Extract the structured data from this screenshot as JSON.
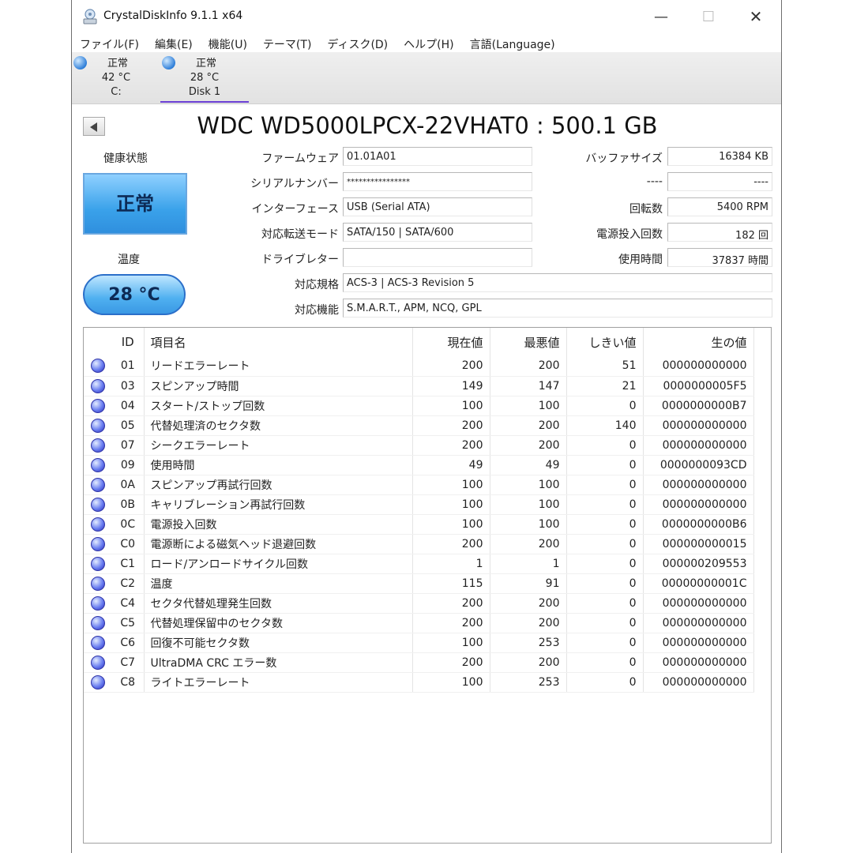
{
  "window": {
    "title": "CrystalDiskInfo 9.1.1 x64"
  },
  "menu": [
    "ファイル(F)",
    "編集(E)",
    "機能(U)",
    "テーマ(T)",
    "ディスク(D)",
    "ヘルプ(H)",
    "言語(Language)"
  ],
  "disks": [
    {
      "status": "正常",
      "temp": "42 °C",
      "name": "C:"
    },
    {
      "status": "正常",
      "temp": "28 °C",
      "name": "Disk 1"
    }
  ],
  "model": "WDC WD5000LPCX-22VHAT0 : 500.1 GB",
  "health": {
    "label": "健康状態",
    "value": "正常"
  },
  "temperature": {
    "label": "温度",
    "value": "28 °C"
  },
  "info": {
    "firmware_label": "ファームウェア",
    "firmware": "01.01A01",
    "serial_label": "シリアルナンバー",
    "serial": "****************",
    "interface_label": "インターフェース",
    "interface": "USB (Serial ATA)",
    "transfer_label": "対応転送モード",
    "transfer": "SATA/150 | SATA/600",
    "drive_letter_label": "ドライブレター",
    "drive_letter": "",
    "standard_label": "対応規格",
    "standard": "ACS-3 | ACS-3 Revision 5",
    "features_label": "対応機能",
    "features": "S.M.A.R.T., APM, NCQ, GPL",
    "buffer_label": "バッファサイズ",
    "buffer": "16384 KB",
    "blank_label": "----",
    "blank": "----",
    "rotation_label": "回転数",
    "rotation": "5400 RPM",
    "power_count_label": "電源投入回数",
    "power_count": "182 回",
    "power_hours_label": "使用時間",
    "power_hours": "37837 時間"
  },
  "smart": {
    "headers": {
      "id": "ID",
      "name": "項目名",
      "current": "現在値",
      "worst": "最悪値",
      "threshold": "しきい値",
      "raw": "生の値"
    },
    "rows": [
      {
        "id": "01",
        "name": "リードエラーレート",
        "current": "200",
        "worst": "200",
        "threshold": "51",
        "raw": "000000000000"
      },
      {
        "id": "03",
        "name": "スピンアップ時間",
        "current": "149",
        "worst": "147",
        "threshold": "21",
        "raw": "0000000005F5"
      },
      {
        "id": "04",
        "name": "スタート/ストップ回数",
        "current": "100",
        "worst": "100",
        "threshold": "0",
        "raw": "0000000000B7"
      },
      {
        "id": "05",
        "name": "代替処理済のセクタ数",
        "current": "200",
        "worst": "200",
        "threshold": "140",
        "raw": "000000000000"
      },
      {
        "id": "07",
        "name": "シークエラーレート",
        "current": "200",
        "worst": "200",
        "threshold": "0",
        "raw": "000000000000"
      },
      {
        "id": "09",
        "name": "使用時間",
        "current": "49",
        "worst": "49",
        "threshold": "0",
        "raw": "0000000093CD"
      },
      {
        "id": "0A",
        "name": "スピンアップ再試行回数",
        "current": "100",
        "worst": "100",
        "threshold": "0",
        "raw": "000000000000"
      },
      {
        "id": "0B",
        "name": "キャリブレーション再試行回数",
        "current": "100",
        "worst": "100",
        "threshold": "0",
        "raw": "000000000000"
      },
      {
        "id": "0C",
        "name": "電源投入回数",
        "current": "100",
        "worst": "100",
        "threshold": "0",
        "raw": "0000000000B6"
      },
      {
        "id": "C0",
        "name": "電源断による磁気ヘッド退避回数",
        "current": "200",
        "worst": "200",
        "threshold": "0",
        "raw": "000000000015"
      },
      {
        "id": "C1",
        "name": "ロード/アンロードサイクル回数",
        "current": "1",
        "worst": "1",
        "threshold": "0",
        "raw": "000000209553"
      },
      {
        "id": "C2",
        "name": "温度",
        "current": "115",
        "worst": "91",
        "threshold": "0",
        "raw": "00000000001C"
      },
      {
        "id": "C4",
        "name": "セクタ代替処理発生回数",
        "current": "200",
        "worst": "200",
        "threshold": "0",
        "raw": "000000000000"
      },
      {
        "id": "C5",
        "name": "代替処理保留中のセクタ数",
        "current": "200",
        "worst": "200",
        "threshold": "0",
        "raw": "000000000000"
      },
      {
        "id": "C6",
        "name": "回復不可能セクタ数",
        "current": "100",
        "worst": "253",
        "threshold": "0",
        "raw": "000000000000"
      },
      {
        "id": "C7",
        "name": "UltraDMA CRC エラー数",
        "current": "200",
        "worst": "200",
        "threshold": "0",
        "raw": "000000000000"
      },
      {
        "id": "C8",
        "name": "ライトエラーレート",
        "current": "100",
        "worst": "253",
        "threshold": "0",
        "raw": "000000000000"
      }
    ]
  }
}
